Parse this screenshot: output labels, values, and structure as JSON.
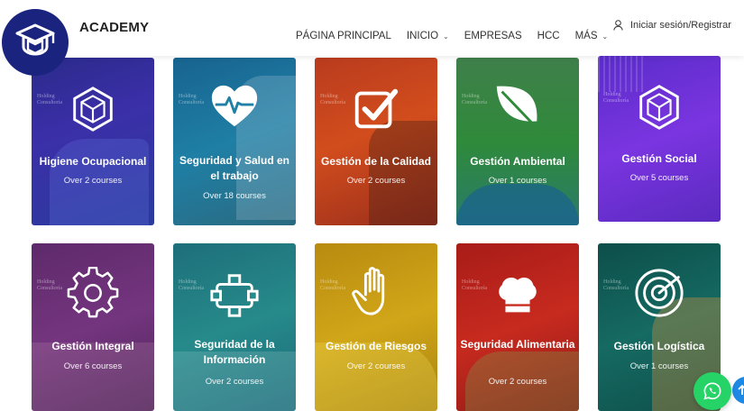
{
  "header": {
    "brand": "ACADEMY",
    "logo_icon": "graduation-cap-icon",
    "logo_color": "#1a237e",
    "nav": [
      {
        "label": "PÁGINA PRINCIPAL",
        "dropdown": false
      },
      {
        "label": "INICIO",
        "dropdown": true
      },
      {
        "label": "EMPRESAS",
        "dropdown": false
      },
      {
        "label": "HCC",
        "dropdown": false
      },
      {
        "label": "MÁS",
        "dropdown": true
      }
    ],
    "login_label": "Iniciar sesión/Registrar",
    "login_icon": "user-icon"
  },
  "categories": [
    {
      "title": "Higiene Ocupacional",
      "count": "Over 2 courses",
      "icon": "cube-icon",
      "color": "#3a2fa0"
    },
    {
      "title": "Seguridad y Salud en el trabajo",
      "count": "Over 18 courses",
      "icon": "heart-pulse-icon",
      "color": "#1d6f96"
    },
    {
      "title": "Gestión de la Calidad",
      "count": "Over 2 courses",
      "icon": "checkbox-icon",
      "color": "#c8431a"
    },
    {
      "title": "Gestión Ambiental",
      "count": "Over 1 courses",
      "icon": "leaf-icon",
      "color": "#2f8a3a"
    },
    {
      "title": "Gestión Social",
      "count": "Over 5 courses",
      "icon": "cube-icon",
      "color": "#6a2bd6"
    },
    {
      "title": "Gestión Integral",
      "count": "Over 6 courses",
      "icon": "gear-icon",
      "color": "#6b2e74"
    },
    {
      "title": "Seguridad de la Información",
      "count": "Over 2 courses",
      "icon": "network-icon",
      "color": "#1e7f82"
    },
    {
      "title": "Gestión de Riesgos",
      "count": "Over 2 courses",
      "icon": "hand-icon",
      "color": "#c69a12"
    },
    {
      "title": "Seguridad Alimentaria",
      "count": "Over 2 courses",
      "icon": "chef-hat-icon",
      "color": "#b8221c"
    },
    {
      "title": "Gestión Logística",
      "count": "Over 1 courses",
      "icon": "radar-icon",
      "color": "#0f5a55"
    }
  ],
  "whatsapp_icon": "whatsapp-icon",
  "whatsapp_color": "#25d366",
  "scroll_top_icon": "arrow-up-icon"
}
